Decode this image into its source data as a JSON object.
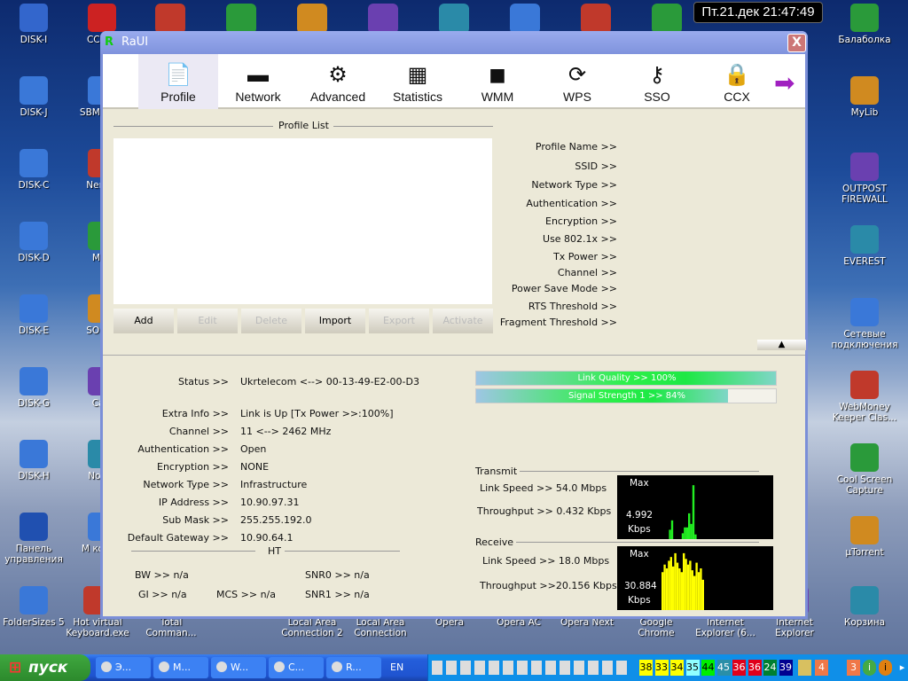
{
  "desktop": {
    "top_row": [
      {
        "label": "DISK-I",
        "x": 0,
        "c": "#3366cc"
      },
      {
        "label": "CCle...",
        "x": 77,
        "c": "#cc2222"
      }
    ],
    "left": [
      {
        "label": "DISK-J"
      },
      {
        "label": "DISK-C"
      },
      {
        "label": "DISK-D"
      },
      {
        "label": "DISK-E"
      },
      {
        "label": "DISK-G"
      },
      {
        "label": "DISK-H"
      },
      {
        "label": "Панель управления"
      }
    ],
    "second_col": [
      {
        "label": "SBMA Cle"
      },
      {
        "label": "Nero R"
      },
      {
        "label": "Mag"
      },
      {
        "label": "SOFTO"
      },
      {
        "label": "Calc"
      },
      {
        "label": "Notep"
      },
      {
        "label": "М компь"
      }
    ],
    "right": [
      {
        "label": "Балаболка"
      },
      {
        "label": "MyLib"
      },
      {
        "label": "OUTPOST FIREWALL"
      },
      {
        "label": "EVEREST"
      },
      {
        "label": "Сетевые подключения"
      },
      {
        "label": "WebMoney Keeper Clas..."
      },
      {
        "label": "Cool Screen Capture"
      },
      {
        "label": "µTorrent"
      }
    ],
    "bottom": [
      {
        "label": "FolderSizes 5"
      },
      {
        "label": "Hot virtual Keyboard.exe"
      },
      {
        "label": "Total Comman..."
      },
      {
        "label": "Local Area Connection 2"
      },
      {
        "label": "Local Area Connection"
      },
      {
        "label": "Opera"
      },
      {
        "label": "Opera AC"
      },
      {
        "label": "Opera Next"
      },
      {
        "label": "Google Chrome"
      },
      {
        "label": "Internet Explorer (6..."
      },
      {
        "label": "Internet Explorer"
      },
      {
        "label": "Корзина"
      }
    ],
    "clipped_right": [
      "o",
      "et"
    ]
  },
  "clock": "Пт.21.дек 21:47:49",
  "window": {
    "title": "RaUI",
    "close": "X",
    "toolbar": [
      {
        "label": "Profile",
        "icon": "profile-icon",
        "g": "📄"
      },
      {
        "label": "Network",
        "icon": "router-icon",
        "g": "▬"
      },
      {
        "label": "Advanced",
        "icon": "gears-icon",
        "g": "⚙"
      },
      {
        "label": "Statistics",
        "icon": "calculator-icon",
        "g": "▦"
      },
      {
        "label": "WMM",
        "icon": "qos-icon",
        "g": "◼"
      },
      {
        "label": "WPS",
        "icon": "wps-icon",
        "g": "⟳"
      },
      {
        "label": "SSO",
        "icon": "keys-icon",
        "g": "⚷"
      },
      {
        "label": "CCX",
        "icon": "lock-icon",
        "g": "🔒"
      }
    ],
    "profile_list_title": "Profile List",
    "buttons": [
      {
        "label": "Add",
        "enabled": true
      },
      {
        "label": "Edit",
        "enabled": false
      },
      {
        "label": "Delete",
        "enabled": false
      },
      {
        "label": "Import",
        "enabled": true
      },
      {
        "label": "Export",
        "enabled": false
      },
      {
        "label": "Activate",
        "enabled": false
      }
    ],
    "profile_fields": [
      "Profile Name >>",
      "SSID >>",
      "Network Type >>",
      "Authentication >>",
      "Encryption >>",
      "Use 802.1x >>",
      "Tx Power >>",
      "Channel >>",
      "Power Save Mode >>",
      "RTS Threshold >>",
      "Fragment Threshold >>"
    ],
    "status": [
      {
        "k": "Status >>",
        "v": "Ukrtelecom <--> 00-13-49-E2-00-D3"
      },
      {
        "k": "Extra Info >>",
        "v": "Link is Up [Tx Power >>:100%]"
      },
      {
        "k": "Channel >>",
        "v": "11 <--> 2462 MHz"
      },
      {
        "k": "Authentication >>",
        "v": "Open"
      },
      {
        "k": "Encryption >>",
        "v": "NONE"
      },
      {
        "k": "Network Type >>",
        "v": "Infrastructure"
      },
      {
        "k": "IP Address >>",
        "v": "10.90.97.31"
      },
      {
        "k": "Sub Mask >>",
        "v": "255.255.192.0"
      },
      {
        "k": "Default Gateway >>",
        "v": "10.90.64.1"
      }
    ],
    "ht": {
      "title": "HT",
      "bw": "BW >>  n/a",
      "gi": "GI >>  n/a",
      "mcs": "MCS >>   n/a",
      "snr0": "SNR0 >>  n/a",
      "snr1": "SNR1 >>  n/a"
    },
    "link_quality": {
      "text": "Link Quality >> 100%",
      "percent": 100
    },
    "signal": {
      "text": "Signal Strength 1 >> 84%",
      "percent": 84
    },
    "transmit": {
      "title": "Transmit",
      "link_speed": "Link Speed >>  54.0 Mbps",
      "throughput": "Throughput >> 0.432 Kbps",
      "max": "Max",
      "max_value": "4.992",
      "unit": "Kbps",
      "color": "#22ee22",
      "history": [
        0,
        0.8,
        1.6,
        0,
        0,
        0,
        0,
        0.5,
        1.0,
        1.0,
        2.2,
        1.3,
        4.6,
        0.4
      ]
    },
    "receive": {
      "title": "Receive",
      "link_speed": "Link Speed >> 18.0 Mbps",
      "throughput": "Throughput >>20.156 Kbps",
      "max": "Max",
      "max_value": "30.884",
      "unit": "Kbps",
      "color": "#ffff00",
      "history": [
        20,
        24,
        22,
        26,
        28,
        23,
        30,
        25,
        22,
        20,
        30,
        27,
        24,
        26,
        21,
        18,
        25,
        20,
        22,
        16
      ]
    }
  },
  "taskbar": {
    "start": "пуск",
    "tasks": [
      {
        "label": "Э...",
        "icon": "opera-icon"
      },
      {
        "label": "M...",
        "icon": "network-icon"
      },
      {
        "label": "W...",
        "icon": "computer-icon"
      },
      {
        "label": "C...",
        "icon": "connection-icon"
      },
      {
        "label": "R...",
        "icon": "raui-icon"
      }
    ],
    "lang": "EN",
    "tray_numbers": [
      {
        "v": "38",
        "bg": "#ffff00",
        "fg": "#000"
      },
      {
        "v": "33",
        "bg": "#ffff00",
        "fg": "#000"
      },
      {
        "v": "34",
        "bg": "#ffff00",
        "fg": "#000"
      },
      {
        "v": "35",
        "bg": "#8fffff",
        "fg": "#000"
      },
      {
        "v": "44",
        "bg": "#00ee00",
        "fg": "#000"
      },
      {
        "v": "45",
        "bg": "#2a8fa8",
        "fg": "#fff"
      },
      {
        "v": "36",
        "bg": "#e0001a",
        "fg": "#fff"
      },
      {
        "v": "36",
        "bg": "#e0001a",
        "fg": "#fff"
      },
      {
        "v": "24",
        "bg": "#008030",
        "fg": "#fff"
      },
      {
        "v": "39",
        "bg": "#000090",
        "fg": "#fff"
      }
    ],
    "badges": [
      "4",
      "3"
    ]
  }
}
